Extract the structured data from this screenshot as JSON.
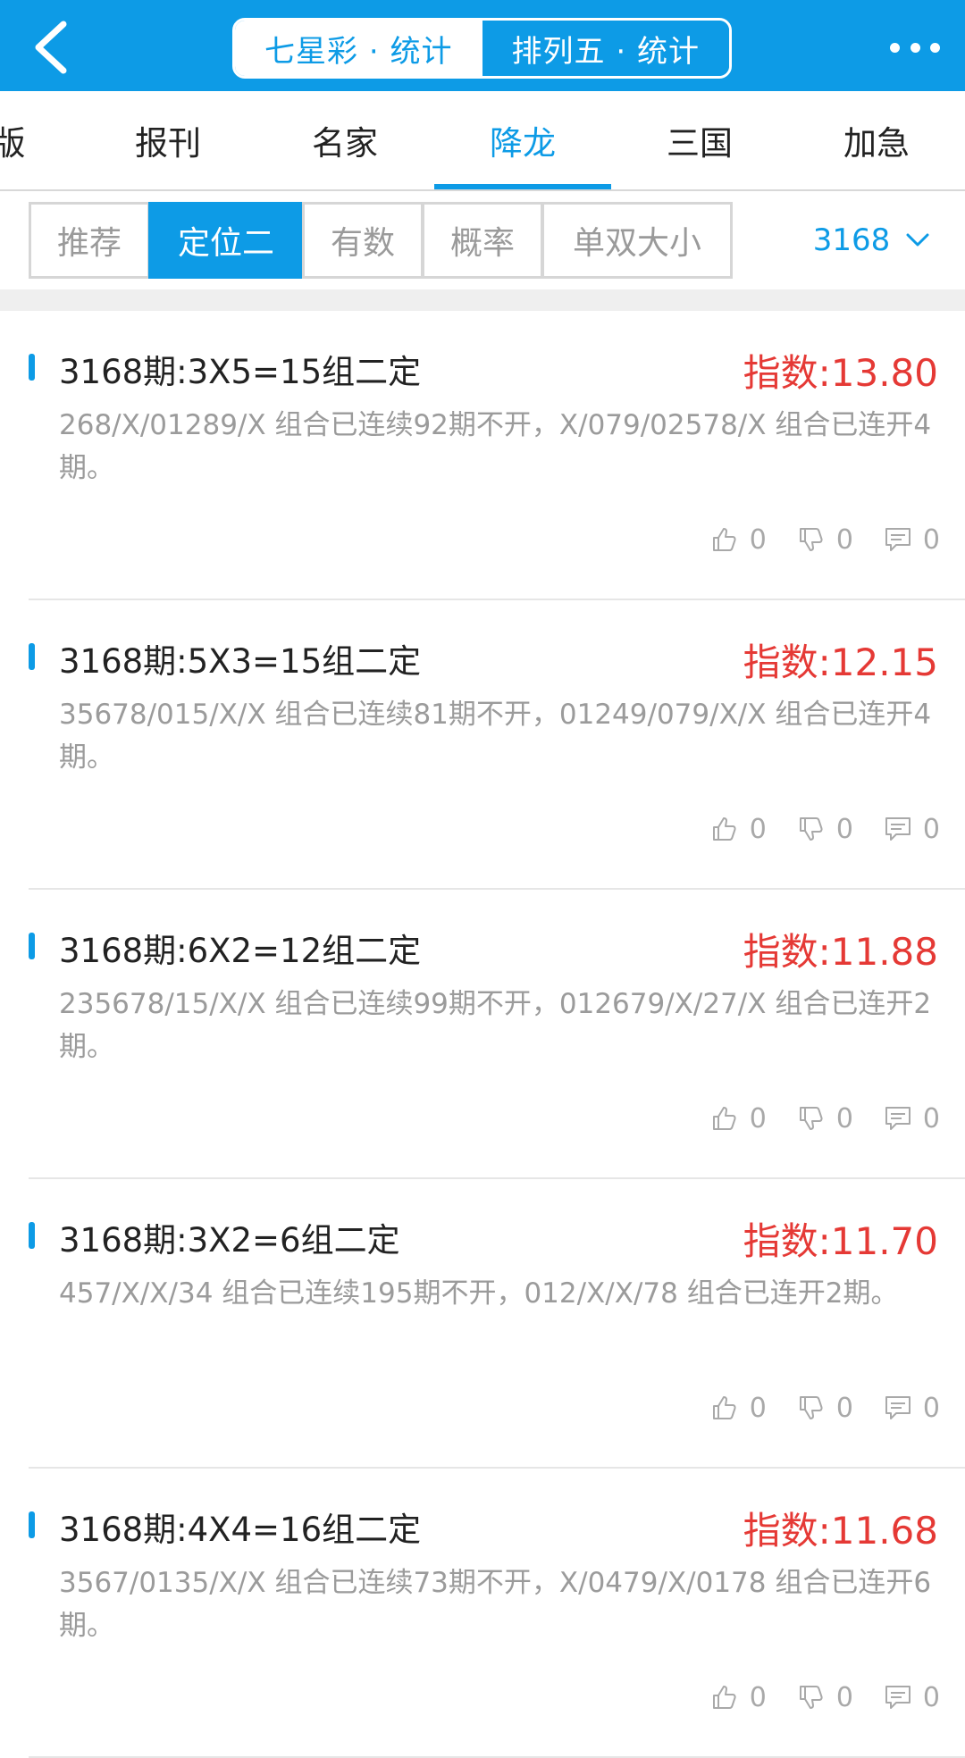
{
  "header": {
    "seg_left": "七星彩 · 统计",
    "seg_right": "排列五 · 统计"
  },
  "tabs": [
    "版",
    "报刊",
    "名家",
    "降龙",
    "三国",
    "加急"
  ],
  "filters": [
    "推荐",
    "定位二",
    "有数",
    "概率",
    "单双大小"
  ],
  "period": "3168",
  "colors": {
    "accent": "#0d9be6",
    "index_red": "#e53935"
  },
  "items": [
    {
      "title": "3168期:3X5=15组二定",
      "index": "指数:13.80",
      "desc": "268/X/01289/X 组合已连续92期不开，X/079/02578/X 组合已连开4期。",
      "likes": "0",
      "dislikes": "0",
      "comments": "0"
    },
    {
      "title": "3168期:5X3=15组二定",
      "index": "指数:12.15",
      "desc": "35678/015/X/X 组合已连续81期不开，01249/079/X/X 组合已连开4期。",
      "likes": "0",
      "dislikes": "0",
      "comments": "0"
    },
    {
      "title": "3168期:6X2=12组二定",
      "index": "指数:11.88",
      "desc": "235678/15/X/X 组合已连续99期不开，012679/X/27/X 组合已连开2期。",
      "likes": "0",
      "dislikes": "0",
      "comments": "0"
    },
    {
      "title": "3168期:3X2=6组二定",
      "index": "指数:11.70",
      "desc": "457/X/X/34 组合已连续195期不开，012/X/X/78 组合已连开2期。",
      "likes": "0",
      "dislikes": "0",
      "comments": "0"
    },
    {
      "title": "3168期:4X4=16组二定",
      "index": "指数:11.68",
      "desc": "3567/0135/X/X 组合已连续73期不开，X/0479/X/0178 组合已连开6期。",
      "likes": "0",
      "dislikes": "0",
      "comments": "0"
    }
  ]
}
